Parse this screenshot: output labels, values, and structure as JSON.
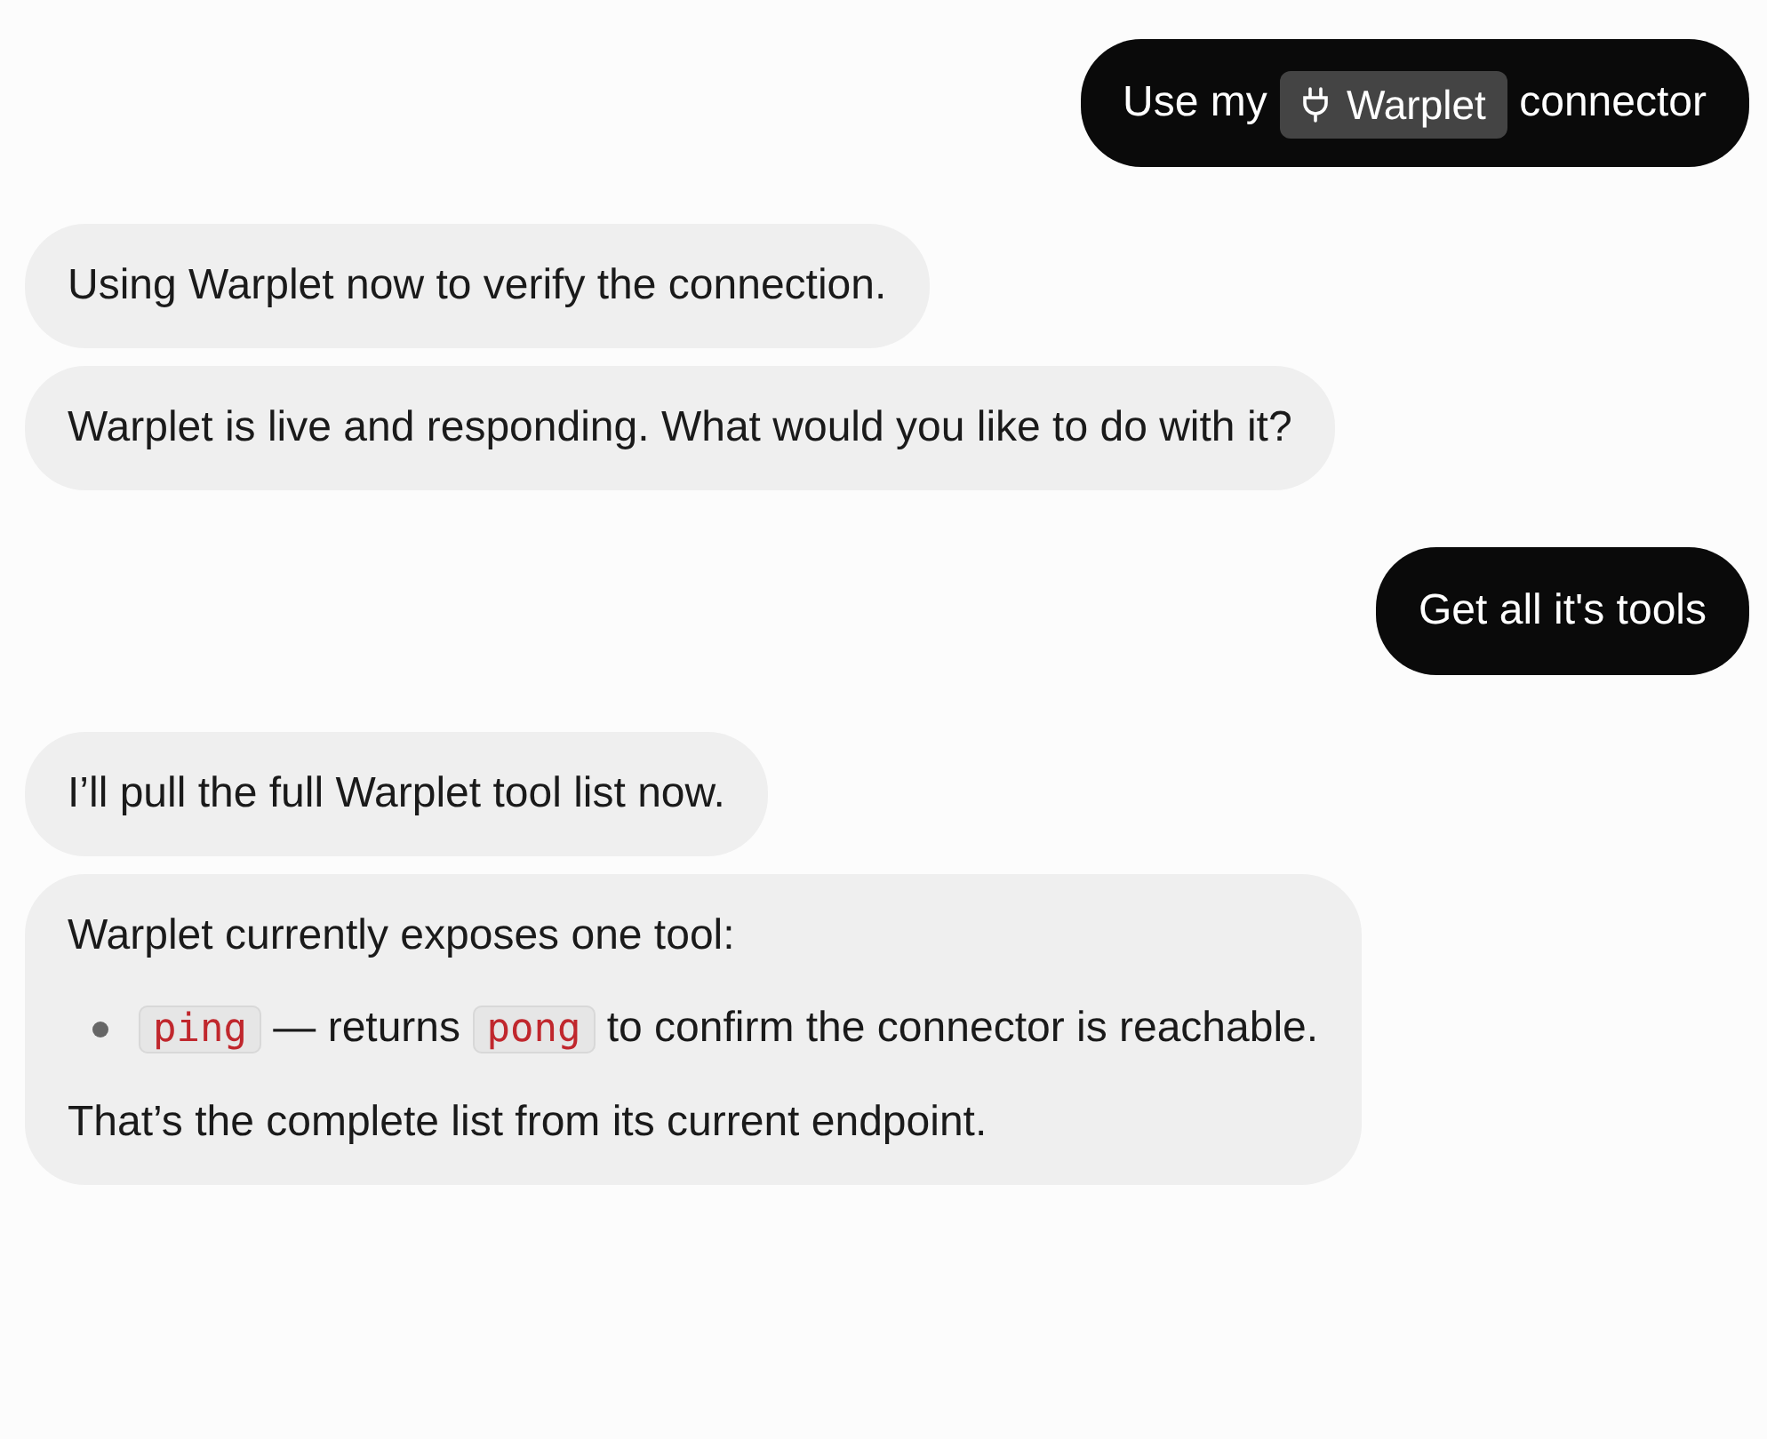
{
  "messages": [
    {
      "kind": "user",
      "bubbles": [
        {
          "blocks": [
            {
              "kind": "paragraph",
              "parts": [
                {
                  "kind": "text",
                  "text": "Use my"
                },
                {
                  "kind": "chip",
                  "text": "Warplet"
                },
                {
                  "kind": "text",
                  "text": "connector"
                }
              ]
            }
          ]
        }
      ]
    },
    {
      "kind": "assistant",
      "bubbles": [
        {
          "blocks": [
            {
              "kind": "paragraph",
              "parts": [
                {
                  "kind": "text",
                  "text": "Using Warplet now to verify the connection."
                }
              ]
            }
          ]
        },
        {
          "blocks": [
            {
              "kind": "paragraph",
              "parts": [
                {
                  "kind": "text",
                  "text": "Warplet is live and responding. What would you like to do with it?"
                }
              ]
            }
          ]
        }
      ]
    },
    {
      "kind": "user",
      "bubbles": [
        {
          "blocks": [
            {
              "kind": "paragraph",
              "parts": [
                {
                  "kind": "text",
                  "text": "Get all it's tools"
                }
              ]
            }
          ]
        }
      ]
    },
    {
      "kind": "assistant",
      "bubbles": [
        {
          "blocks": [
            {
              "kind": "paragraph",
              "parts": [
                {
                  "kind": "text",
                  "text": "I’ll pull the full Warplet tool list now."
                }
              ]
            }
          ]
        },
        {
          "blocks": [
            {
              "kind": "paragraph",
              "parts": [
                {
                  "kind": "text",
                  "text": "Warplet currently exposes one tool:"
                }
              ]
            },
            {
              "kind": "list",
              "items": [
                {
                  "parts": [
                    {
                      "kind": "code",
                      "text": "ping"
                    },
                    {
                      "kind": "text",
                      "text": "— returns"
                    },
                    {
                      "kind": "code",
                      "text": "pong"
                    },
                    {
                      "kind": "text",
                      "text": "to confirm the connector is reachable."
                    }
                  ]
                }
              ]
            },
            {
              "kind": "paragraph",
              "parts": [
                {
                  "kind": "text",
                  "text": "That’s the complete list from its current endpoint."
                }
              ]
            }
          ]
        }
      ]
    }
  ]
}
